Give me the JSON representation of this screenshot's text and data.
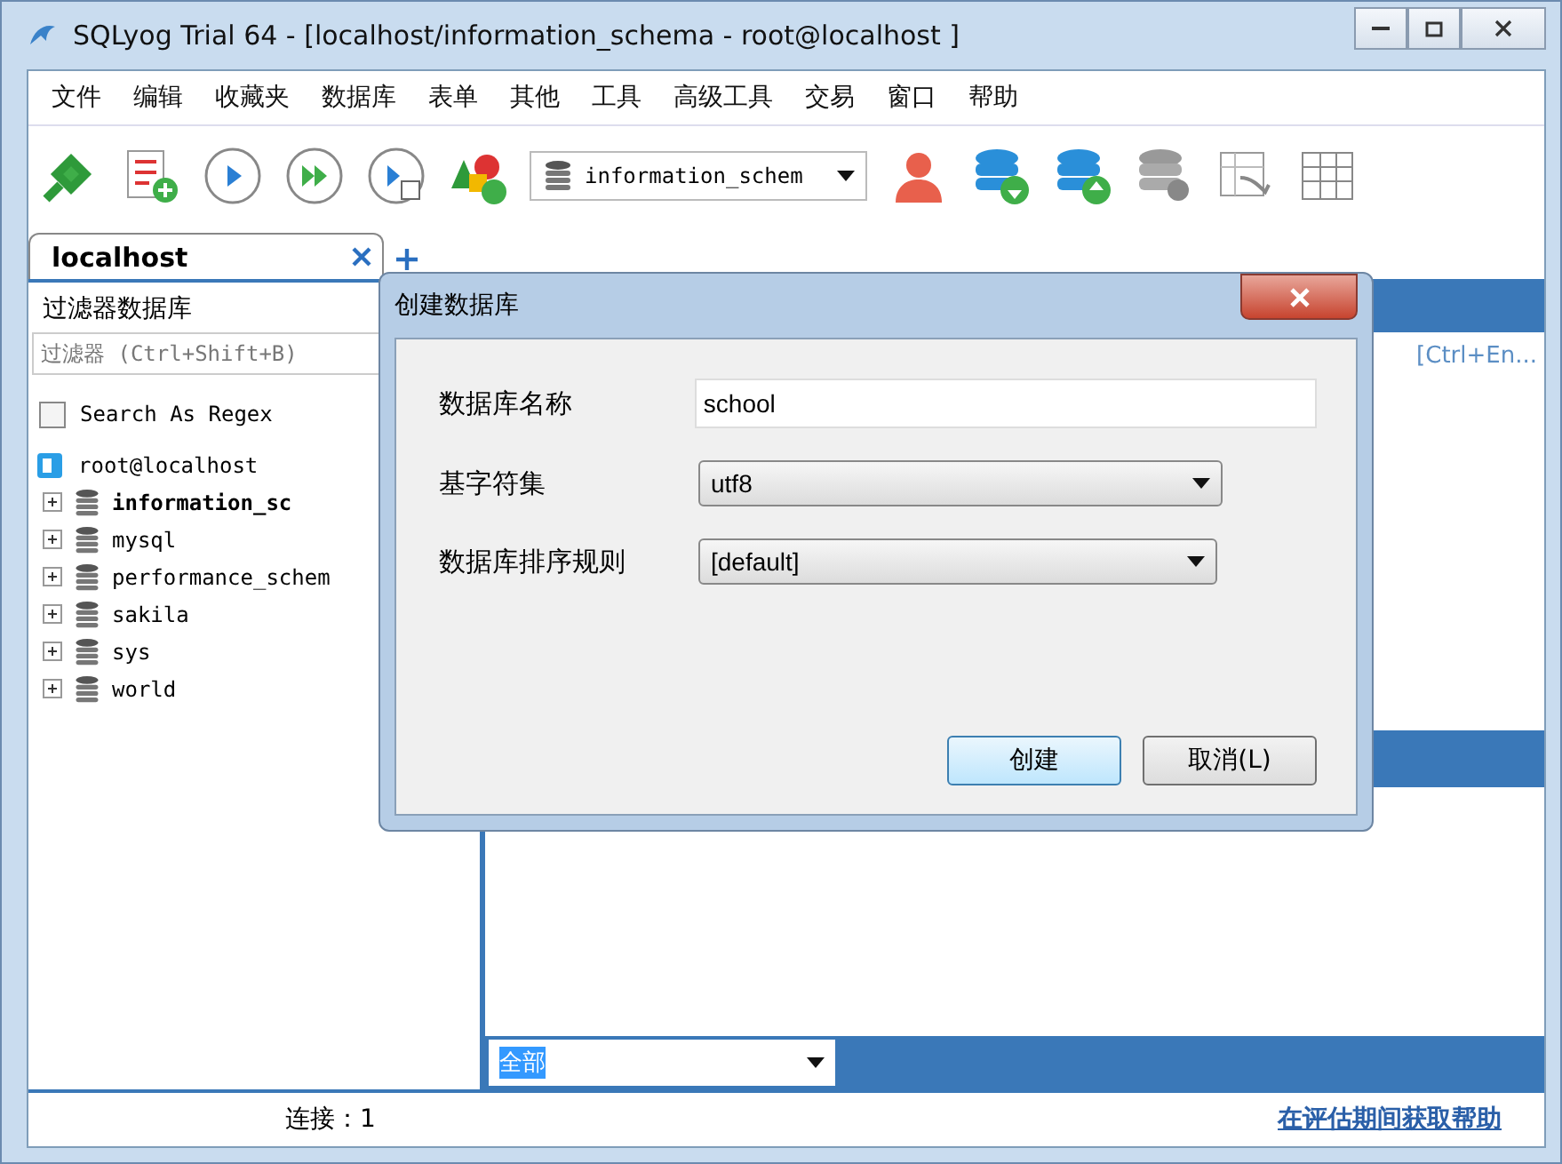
{
  "window": {
    "title": "SQLyog Trial 64 - [localhost/information_schema - root@localhost ]"
  },
  "menu": [
    "文件",
    "编辑",
    "收藏夹",
    "数据库",
    "表单",
    "其他",
    "工具",
    "高级工具",
    "交易",
    "窗口",
    "帮助"
  ],
  "toolbar": {
    "database_select": "information_schem"
  },
  "tabs": [
    {
      "label": "localhost",
      "selected": true
    }
  ],
  "left_panel": {
    "title": "过滤器数据库",
    "filter": {
      "placeholder": "过滤器 (Ctrl+Shift+B)"
    },
    "regex": {
      "label": "Search As Regex",
      "checked": false
    },
    "tree": [
      {
        "name": "root@localhost",
        "children": [
          {
            "name": "information_sc",
            "selected": true
          },
          {
            "name": "mysql",
            "selected": false
          },
          {
            "name": "performance_schem",
            "selected": false
          },
          {
            "name": "sakila",
            "selected": false
          },
          {
            "name": "sys",
            "selected": false
          },
          {
            "name": "world",
            "selected": false
          }
        ]
      }
    ]
  },
  "right_panel": {
    "hint": "[Ctrl+En...",
    "filter_select": "全部"
  },
  "dialog": {
    "title": "创建数据库",
    "fields": [
      {
        "label": "数据库名称",
        "kind": "input",
        "value": "school"
      },
      {
        "label": "基字符集",
        "kind": "select",
        "value": "utf8"
      },
      {
        "label": "数据库排序规则",
        "kind": "select",
        "value": "[default]"
      }
    ],
    "buttons": [
      {
        "label": "创建",
        "default": true
      },
      {
        "label": "取消(L)",
        "default": false
      }
    ]
  },
  "status_bar": {
    "connections": "连接：1",
    "help_link": "在评估期间获取帮助"
  }
}
